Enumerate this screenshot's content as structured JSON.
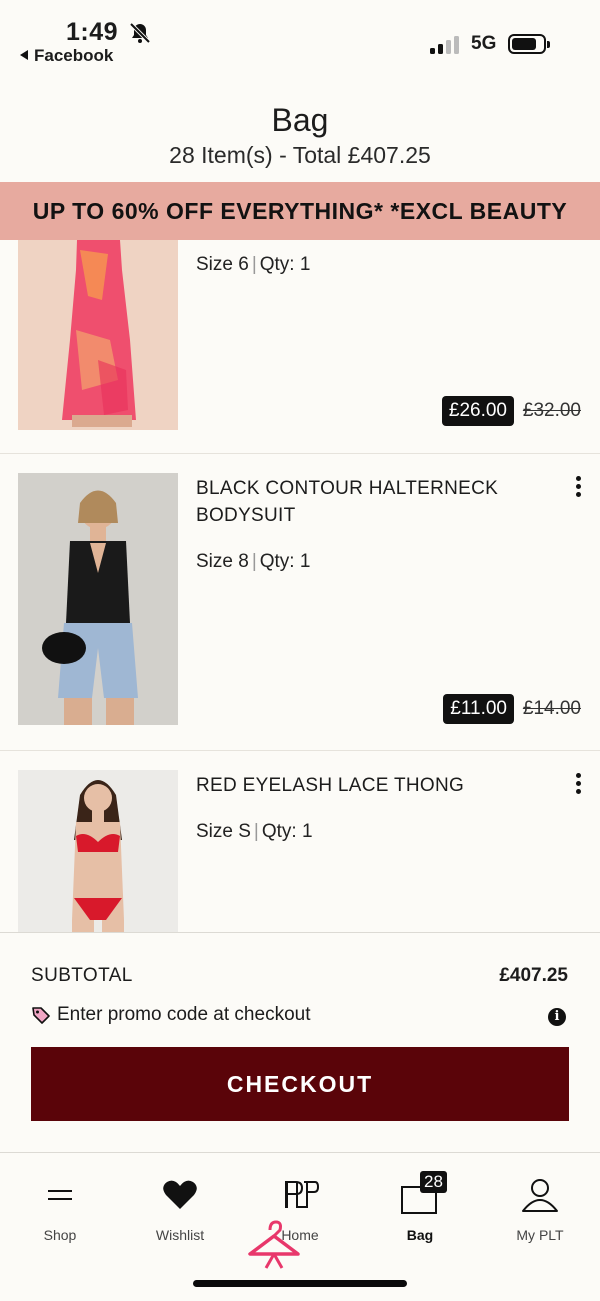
{
  "status_bar": {
    "time": "1:49",
    "back_app": "Facebook",
    "network": "5G"
  },
  "header": {
    "title": "Bag",
    "subtitle": "28 Item(s) - Total £407.25"
  },
  "banner": {
    "text": "UP TO 60% OFF EVERYTHING* *EXCL BEAUTY",
    "color": "#e7aa9f"
  },
  "items": [
    {
      "name": "",
      "size": "Size 6",
      "qty": "Qty: 1",
      "price_now": "£26.00",
      "price_was": "£32.00"
    },
    {
      "name": "BLACK CONTOUR HALTERNECK BODYSUIT",
      "size": "Size 8",
      "qty": "Qty: 1",
      "price_now": "£11.00",
      "price_was": "£14.00"
    },
    {
      "name": "RED EYELASH LACE THONG",
      "size": "Size S",
      "qty": "Qty: 1"
    }
  ],
  "summary": {
    "subtotal_label": "SUBTOTAL",
    "subtotal_value": "£407.25",
    "promo_text": "Enter promo code at checkout",
    "checkout_label": "CHECKOUT",
    "checkout_color": "#5a0409"
  },
  "nav": {
    "shop": "Shop",
    "wishlist": "Wishlist",
    "home": "Home",
    "bag": "Bag",
    "bag_count": "28",
    "account": "My PLT"
  }
}
